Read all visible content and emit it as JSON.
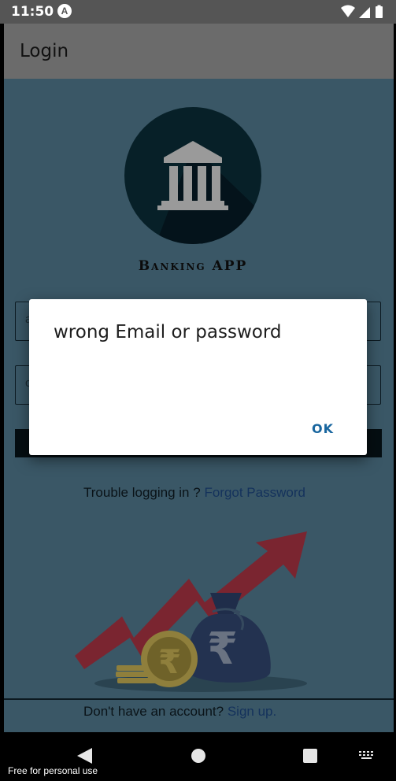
{
  "status_bar": {
    "time": "11:50",
    "app_icon_letter": "A"
  },
  "app_bar": {
    "title": "Login"
  },
  "logo": {
    "text": "Banking APP",
    "icon": "bank-building-icon"
  },
  "form": {
    "email_hint": "a",
    "password_hint": "c"
  },
  "links": {
    "trouble_text": "Trouble logging in ?",
    "forgot_label": "Forgot Password",
    "no_account_text": "Don't have an account?",
    "signup_label": "Sign up."
  },
  "dialog": {
    "message": "wrong Email or password",
    "ok_label": "OK"
  },
  "watermark": "Free for personal use",
  "colors": {
    "scrim_content": "#3a5766",
    "dialog_accent": "#19669f",
    "link": "#14325c"
  }
}
